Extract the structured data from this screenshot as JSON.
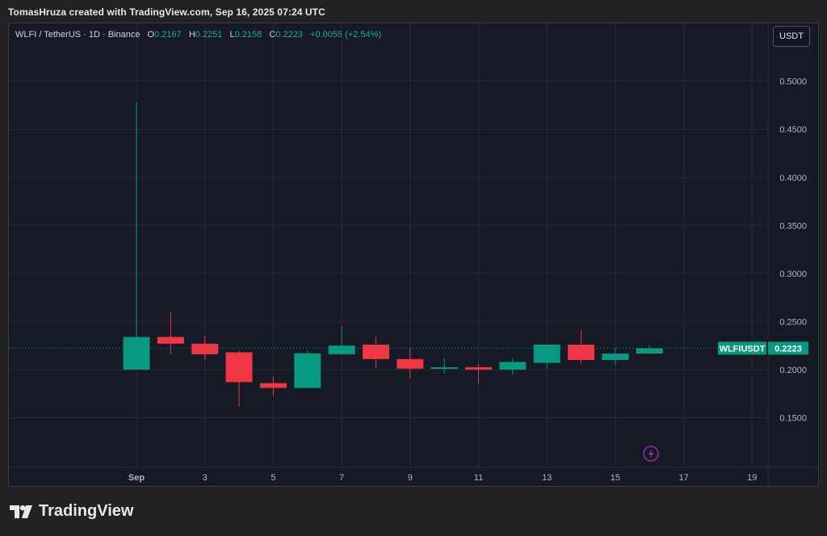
{
  "attribution": "TomasHruza created with TradingView.com, Sep 16, 2025 07:24 UTC",
  "legend": {
    "symbol": "WLFI / TetherUS · 1D · Binance",
    "o_label": "O",
    "o_value": "0.2167",
    "h_label": "H",
    "h_value": "0.2251",
    "l_label": "L",
    "l_value": "0.2158",
    "c_label": "C",
    "c_value": "0.2223",
    "change": "+0.0055 (+2.54%)"
  },
  "currency_button": "USDT",
  "footer_brand": "TradingView",
  "colors": {
    "up": "#089981",
    "down": "#f23645",
    "background": "#161a25",
    "grid": "#262b37",
    "axis_text": "#b2b5be",
    "flash_icon": "#9c27b0"
  },
  "icons": [
    "flash-icon",
    "tradingview-logo-icon"
  ],
  "chart_data": {
    "type": "candlestick",
    "title": "WLFI / TetherUS · 1D · Binance",
    "x": [
      "2025-09-01",
      "2025-09-02",
      "2025-09-03",
      "2025-09-04",
      "2025-09-05",
      "2025-09-06",
      "2025-09-07",
      "2025-09-08",
      "2025-09-09",
      "2025-09-10",
      "2025-09-11",
      "2025-09-12",
      "2025-09-13",
      "2025-09-14",
      "2025-09-15",
      "2025-09-16"
    ],
    "open": [
      0.2,
      0.234,
      0.227,
      0.218,
      0.186,
      0.181,
      0.216,
      0.226,
      0.211,
      0.2015,
      0.2025,
      0.2,
      0.207,
      0.226,
      0.21,
      0.2167
    ],
    "high": [
      0.478,
      0.26,
      0.235,
      0.22,
      0.193,
      0.22,
      0.245,
      0.234,
      0.223,
      0.212,
      0.206,
      0.212,
      0.226,
      0.241,
      0.223,
      0.2251
    ],
    "low": [
      0.2,
      0.216,
      0.21,
      0.161,
      0.173,
      0.181,
      0.216,
      0.202,
      0.191,
      0.196,
      0.186,
      0.195,
      0.201,
      0.206,
      0.205,
      0.2158
    ],
    "close": [
      0.234,
      0.227,
      0.216,
      0.187,
      0.181,
      0.217,
      0.225,
      0.211,
      0.201,
      0.2025,
      0.2,
      0.208,
      0.226,
      0.21,
      0.2167,
      0.2223
    ],
    "x_tick_labels": [
      "Sep",
      "3",
      "5",
      "7",
      "9",
      "11",
      "13",
      "15",
      "17",
      "19"
    ],
    "x_tick_days": [
      1,
      3,
      5,
      7,
      9,
      11,
      13,
      15,
      17,
      19
    ],
    "y_ticks": [
      0.15,
      0.2,
      0.25,
      0.3,
      0.35,
      0.4,
      0.45,
      0.5
    ],
    "y_tick_labels": [
      "0.1500",
      "0.2000",
      "0.2500",
      "0.3000",
      "0.3500",
      "0.4000",
      "0.4500",
      "0.5000"
    ],
    "ylim": [
      0.1,
      0.535
    ],
    "grid": true,
    "last_price": 0.2223,
    "last_price_label": "0.2223",
    "symbol_label": "WLFIUSDT"
  }
}
